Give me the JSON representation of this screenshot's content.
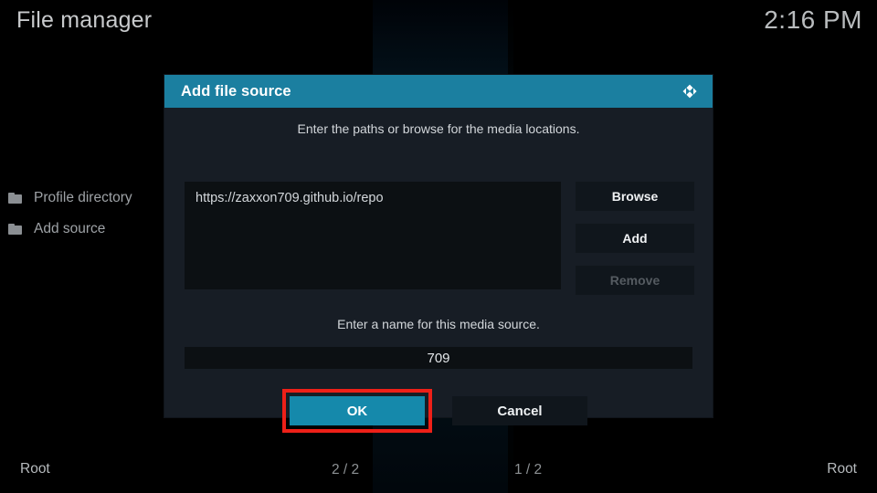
{
  "window": {
    "app_title": "File manager",
    "clock": "2:16 PM"
  },
  "sidebar": {
    "items": [
      {
        "label": "Profile directory",
        "icon": "folder-icon"
      },
      {
        "label": "Add source",
        "icon": "folder-icon"
      }
    ]
  },
  "dialog": {
    "title": "Add file source",
    "logo_icon": "kodi-logo-icon",
    "path_hint": "Enter the paths or browse for the media locations.",
    "path_value": "https://zaxxon709.github.io/repo",
    "side_buttons": [
      {
        "label": "Browse",
        "enabled": true
      },
      {
        "label": "Add",
        "enabled": true
      },
      {
        "label": "Remove",
        "enabled": false
      }
    ],
    "name_hint": "Enter a name for this media source.",
    "name_value": "709",
    "ok_label": "OK",
    "cancel_label": "Cancel"
  },
  "footer": {
    "left_label": "Root",
    "left_pages": "2 / 2",
    "right_pages": "1 / 2",
    "right_label": "Root"
  },
  "colors": {
    "accent": "#1b7fa0",
    "primary_button": "#1589ab",
    "highlight_box": "#ee2018",
    "dialog_bg": "#171d25",
    "field_bg": "#0c1013"
  }
}
